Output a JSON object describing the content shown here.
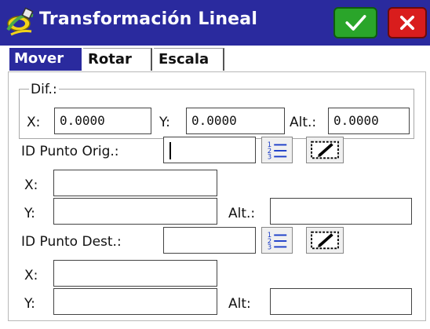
{
  "window": {
    "title": "Transformación Lineal"
  },
  "tabs": [
    "Mover",
    "Rotar",
    "Escala"
  ],
  "difference": {
    "legend": "Dif.:",
    "x_label": "X:",
    "x_value": "0.0000",
    "y_label": "Y:",
    "y_value": "0.0000",
    "alt_label": "Alt.:",
    "alt_value": "0.0000"
  },
  "origin": {
    "id_label": "ID Punto Orig.:",
    "id_value": "",
    "x_label": "X:",
    "x_value": "",
    "y_label": "Y:",
    "y_value": "",
    "alt_label": "Alt.:",
    "alt_value": ""
  },
  "destination": {
    "id_label": "ID Punto Dest.:",
    "id_value": "",
    "x_label": "X:",
    "x_value": "",
    "y_label": "Y:",
    "y_value": "",
    "alt_label": "Alt:",
    "alt_value": ""
  },
  "icons": {
    "app": "satellite-icon",
    "ok": "checkmark-icon",
    "close": "close-icon",
    "list": "list-icon",
    "edit": "edit-icon"
  },
  "colors": {
    "titlebar": "#2a2a9e",
    "ok_button": "#2aa52a",
    "close_button": "#d91d1d",
    "active_tab": "#2a2a9e"
  }
}
